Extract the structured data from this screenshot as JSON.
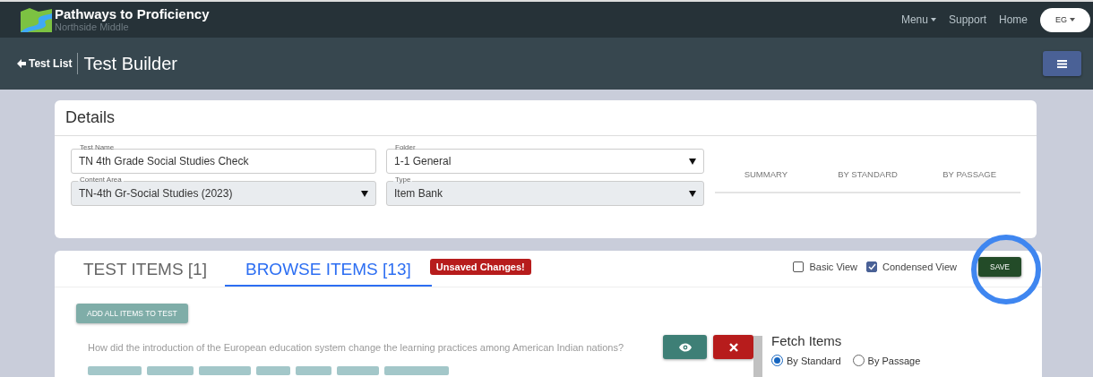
{
  "navbar": {
    "title": "Pathways to Proficiency",
    "subtitle": "Northside Middle",
    "links": [
      {
        "label": "Menu",
        "dropdown": true
      },
      {
        "label": "Support",
        "dropdown": false
      },
      {
        "label": "Home",
        "dropdown": false
      }
    ],
    "user": "EG"
  },
  "header": {
    "back": "Test List",
    "title": "Test Builder"
  },
  "details": {
    "title": "Details",
    "fields": [
      {
        "label": "Test Name",
        "value": "TN 4th Grade Social Studies Check",
        "kind": "text",
        "disabled": false
      },
      {
        "label": "Folder",
        "value": "1-1 General",
        "kind": "select",
        "disabled": false
      },
      {
        "label": "Content Area",
        "value": "TN-4th Gr-Social Studies (2023)",
        "kind": "select",
        "disabled": true
      },
      {
        "label": "Type",
        "value": "Item Bank",
        "kind": "select",
        "disabled": true
      }
    ],
    "summary_tabs": [
      "SUMMARY",
      "BY STANDARD",
      "BY PASSAGE"
    ]
  },
  "items": {
    "tabs": [
      {
        "label": "TEST ITEMS [1]",
        "selected": false
      },
      {
        "label": "BROWSE ITEMS [13]",
        "selected": true
      }
    ],
    "badge": "Unsaved Changes!",
    "options": [
      {
        "label": "Basic View",
        "checked": false
      },
      {
        "label": "Condensed View",
        "checked": true
      }
    ],
    "save": "SAVE",
    "add_all": "ADD ALL ITEMS TO TEST",
    "question": "How did the introduction of the European education system change the learning practices among American Indian nations?",
    "fetch": {
      "title": "Fetch Items",
      "modes": [
        {
          "label": "By Standard",
          "selected": true
        },
        {
          "label": "By Passage",
          "selected": false
        }
      ]
    }
  }
}
